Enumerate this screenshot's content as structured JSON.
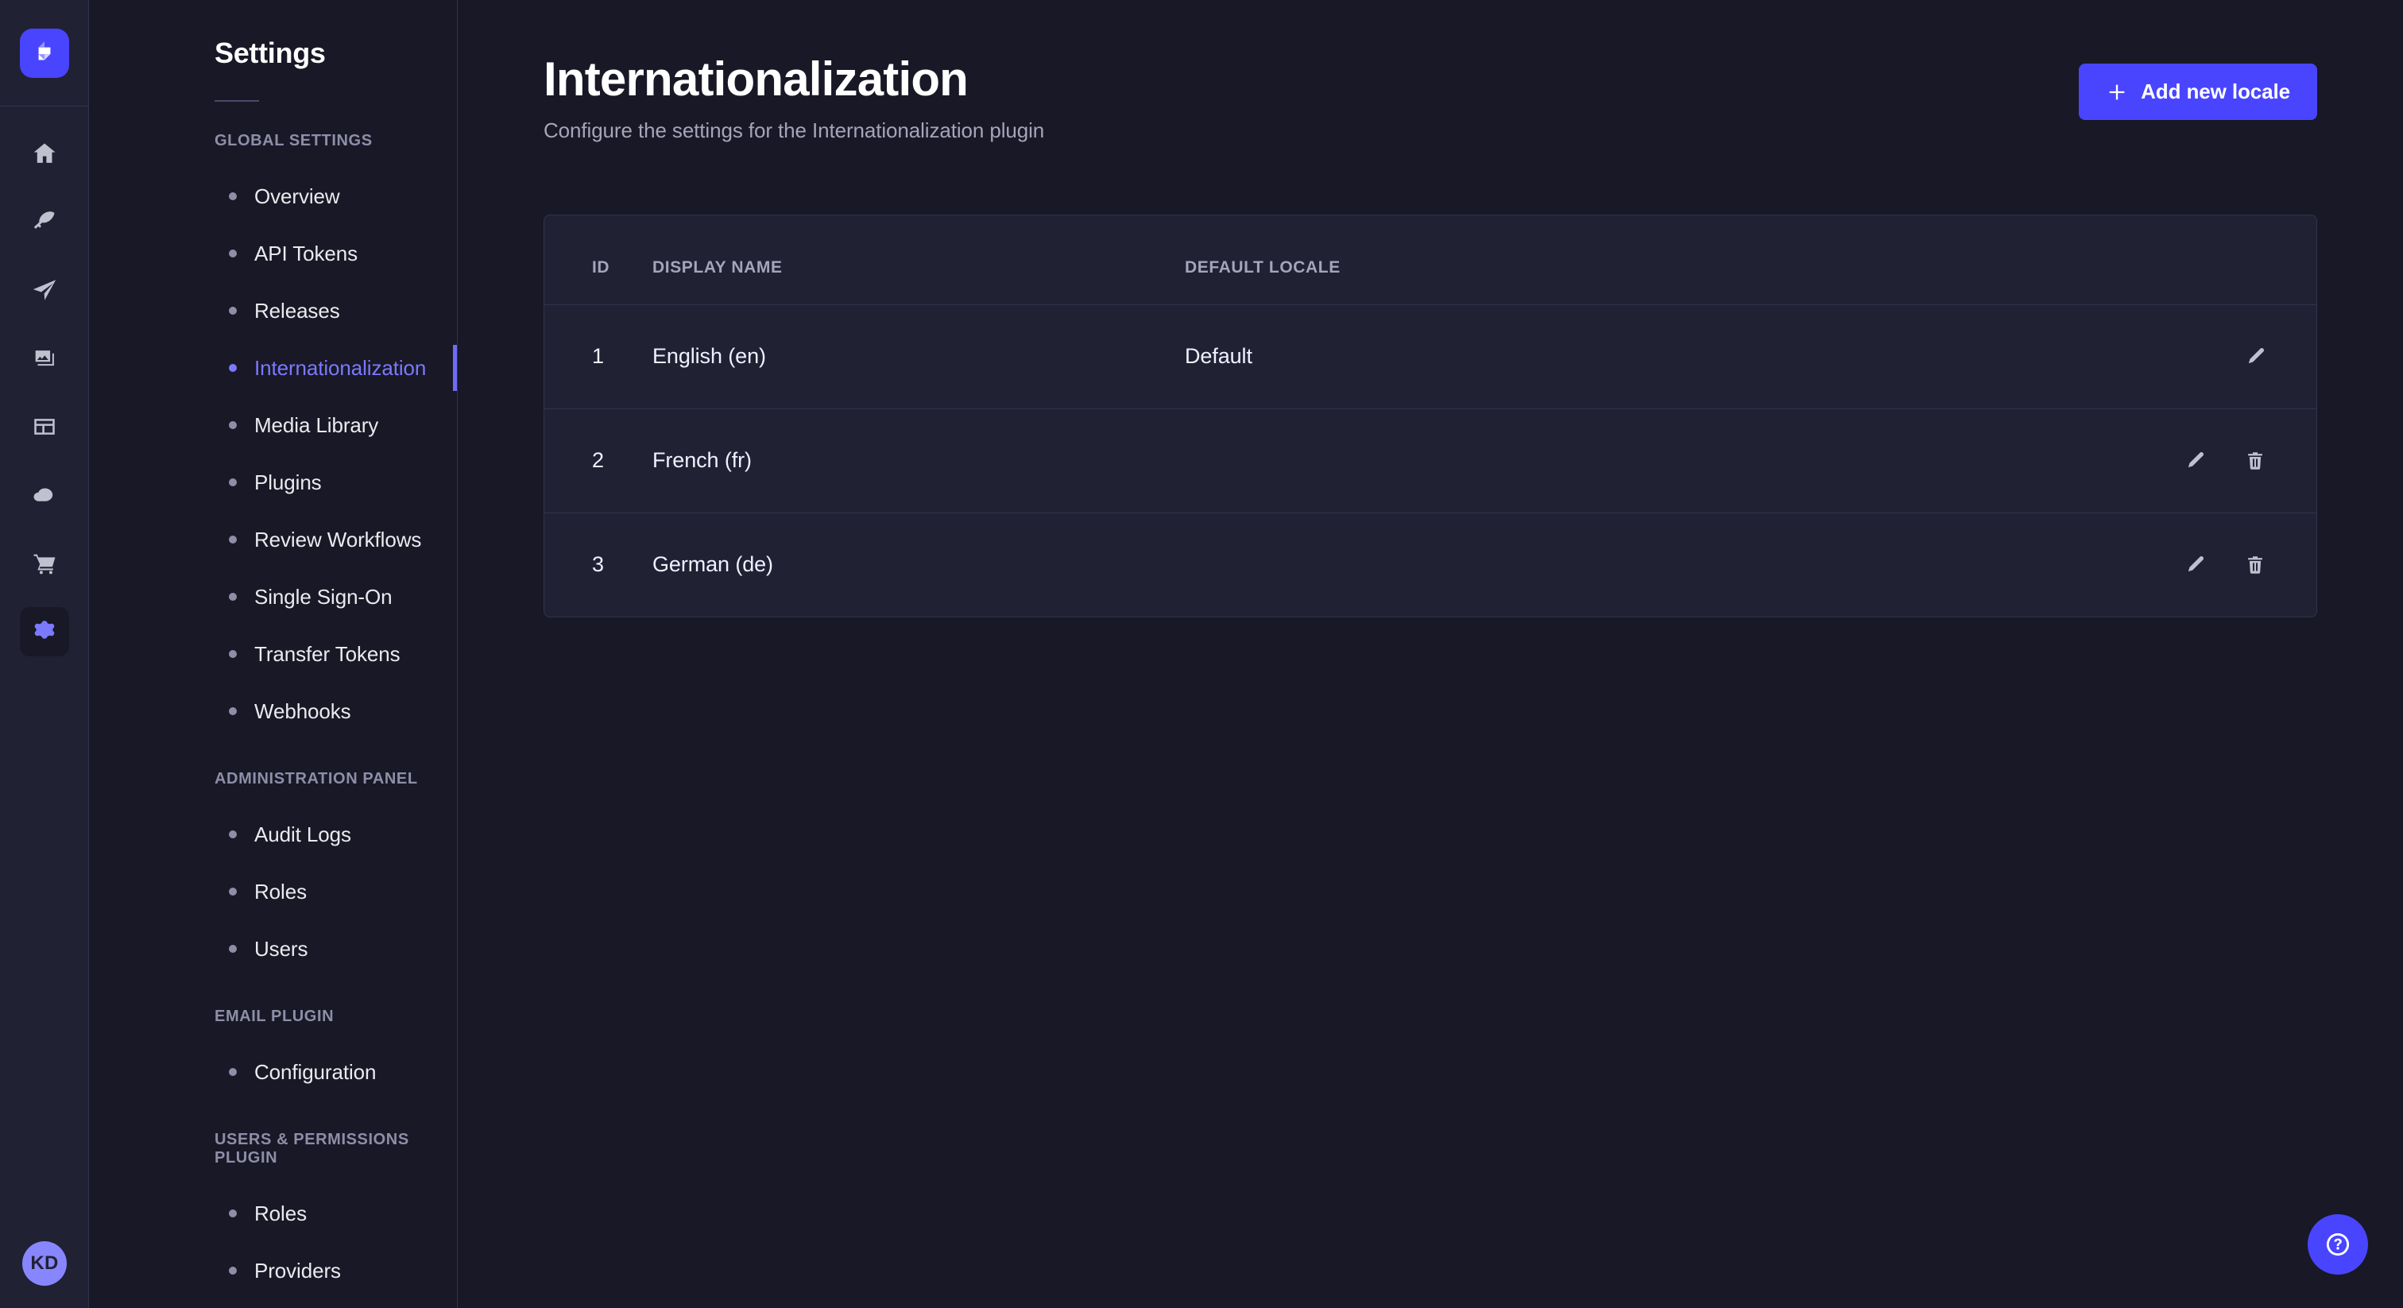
{
  "brand": {
    "logo_icon": "strapi-logo-icon",
    "logo_color": "#4945ff"
  },
  "rail": {
    "items": [
      {
        "icon": "home-icon",
        "name": "home",
        "active": false
      },
      {
        "icon": "feather-icon",
        "name": "content-manager",
        "active": false
      },
      {
        "icon": "paper-plane-icon",
        "name": "content-type-builder",
        "active": false
      },
      {
        "icon": "images-icon",
        "name": "media-library",
        "active": false
      },
      {
        "icon": "layout-icon",
        "name": "pages",
        "active": false
      },
      {
        "icon": "cloud-icon",
        "name": "cloud",
        "active": false
      },
      {
        "icon": "shopping-cart-icon",
        "name": "marketplace",
        "active": false
      },
      {
        "icon": "gear-icon",
        "name": "settings",
        "active": true
      }
    ],
    "avatar": {
      "initials": "KD",
      "color": "#8886ff"
    }
  },
  "sidebar": {
    "title": "Settings",
    "sections": [
      {
        "label": "GLOBAL SETTINGS",
        "items": [
          {
            "label": "Overview",
            "active": false
          },
          {
            "label": "API Tokens",
            "active": false
          },
          {
            "label": "Releases",
            "active": false
          },
          {
            "label": "Internationalization",
            "active": true
          },
          {
            "label": "Media Library",
            "active": false
          },
          {
            "label": "Plugins",
            "active": false
          },
          {
            "label": "Review Workflows",
            "active": false
          },
          {
            "label": "Single Sign-On",
            "active": false
          },
          {
            "label": "Transfer Tokens",
            "active": false
          },
          {
            "label": "Webhooks",
            "active": false
          }
        ]
      },
      {
        "label": "ADMINISTRATION PANEL",
        "items": [
          {
            "label": "Audit Logs",
            "active": false
          },
          {
            "label": "Roles",
            "active": false
          },
          {
            "label": "Users",
            "active": false
          }
        ]
      },
      {
        "label": "EMAIL PLUGIN",
        "items": [
          {
            "label": "Configuration",
            "active": false
          }
        ]
      },
      {
        "label": "USERS & PERMISSIONS PLUGIN",
        "items": [
          {
            "label": "Roles",
            "active": false
          },
          {
            "label": "Providers",
            "active": false
          }
        ]
      }
    ]
  },
  "header": {
    "title": "Internationalization",
    "subtitle": "Configure the settings for the Internationalization plugin",
    "add_button_label": "Add new locale",
    "add_button_icon": "plus-icon",
    "accent_color": "#4945ff"
  },
  "table": {
    "columns": [
      "ID",
      "DISPLAY NAME",
      "DEFAULT LOCALE",
      ""
    ],
    "rows": [
      {
        "id": "1",
        "display_name": "English (en)",
        "default_locale": "Default",
        "can_edit": true,
        "can_delete": false
      },
      {
        "id": "2",
        "display_name": "French (fr)",
        "default_locale": "",
        "can_edit": true,
        "can_delete": true
      },
      {
        "id": "3",
        "display_name": "German (de)",
        "default_locale": "",
        "can_edit": true,
        "can_delete": true
      }
    ]
  },
  "help": {
    "icon": "question-mark-circle-icon",
    "color": "#4945ff"
  }
}
